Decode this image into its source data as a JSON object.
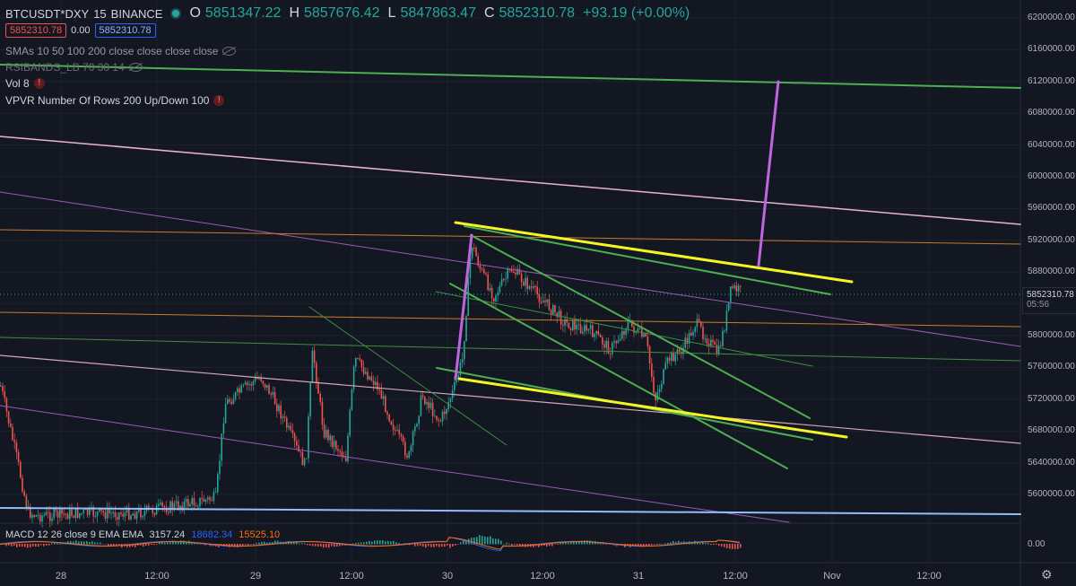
{
  "header": {
    "symbol": "BTCUSDT*DXY",
    "interval": "15",
    "exchange": "BINANCE",
    "ohlc": {
      "o_label": "O",
      "o": "5851347.22",
      "h_label": "H",
      "h": "5857676.42",
      "l_label": "L",
      "l": "5847863.47",
      "c_label": "C",
      "c": "5852310.78",
      "change": "+93.19 (+0.00%)"
    },
    "sell_price": "5852310.78",
    "spread": "0.00",
    "buy_price": "5852310.78"
  },
  "indicators": [
    {
      "label": "SMAs 10 50 100 200 close close close close",
      "has_eye": true,
      "has_warn": false
    },
    {
      "label": "RSIBANDS_LB 70 30 14",
      "has_eye": true,
      "has_warn": false
    },
    {
      "label": "Vol 8",
      "has_eye": false,
      "has_warn": true
    },
    {
      "label": "VPVR Number Of Rows 200 Up/Down 100",
      "has_eye": false,
      "has_warn": true
    }
  ],
  "price_scale": [
    "6200000.00",
    "6160000.00",
    "6120000.00",
    "6080000.00",
    "6040000.00",
    "6000000.00",
    "5960000.00",
    "5920000.00",
    "5880000.00",
    "5840000.00",
    "5800000.00",
    "5760000.00",
    "5720000.00",
    "5680000.00",
    "5640000.00",
    "5600000.00"
  ],
  "last_price": {
    "value": "5852310.78",
    "countdown": "05:56"
  },
  "time_axis": [
    "28",
    "12:00",
    "29",
    "12:00",
    "30",
    "12:00",
    "31",
    "12:00",
    "Nov",
    "12:00"
  ],
  "macd": {
    "label": "MACD 12 26 close 9 EMA EMA",
    "v1": "3157.24",
    "v2": "18682.34",
    "v3": "15525.10",
    "zero_label": "0.00"
  },
  "colors": {
    "bg": "#131722",
    "up": "#26a69a",
    "down": "#ef5350",
    "green_line": "#4caf50",
    "yellow_line": "#f5f526",
    "pink_line": "#e8b4c8",
    "purple_line": "#b45cd6",
    "orange_line": "#c97a2c",
    "blue_line": "#90bff9"
  },
  "icons": {
    "settings": "gear-icon",
    "visibility": "eye-icon",
    "warning": "warn-icon"
  },
  "chart_data": {
    "type": "candlestick",
    "y_min": 5580000,
    "y_max": 6210000,
    "approx_close_path": [
      [
        "28 00:00",
        5700000
      ],
      [
        "28 06:00",
        5620000
      ],
      [
        "28 12:00",
        5560000
      ],
      [
        "28 18:00",
        5580000
      ],
      [
        "29 00:00",
        5730000
      ],
      [
        "29 03:00",
        5760000
      ],
      [
        "29 06:00",
        5720000
      ],
      [
        "29 09:00",
        5660000
      ],
      [
        "29 12:00",
        5740000
      ],
      [
        "29 15:00",
        5660000
      ],
      [
        "29 18:00",
        5730000
      ],
      [
        "29 21:00",
        5690000
      ],
      [
        "30 00:00",
        5720000
      ],
      [
        "30 03:00",
        5860000
      ],
      [
        "30 06:00",
        5880000
      ],
      [
        "30 12:00",
        5850000
      ],
      [
        "30 18:00",
        5810000
      ],
      [
        "31 00:00",
        5800000
      ],
      [
        "31 03:00",
        5740000
      ],
      [
        "31 06:00",
        5770000
      ],
      [
        "31 09:00",
        5800000
      ],
      [
        "31 12:00",
        5852310
      ]
    ]
  }
}
